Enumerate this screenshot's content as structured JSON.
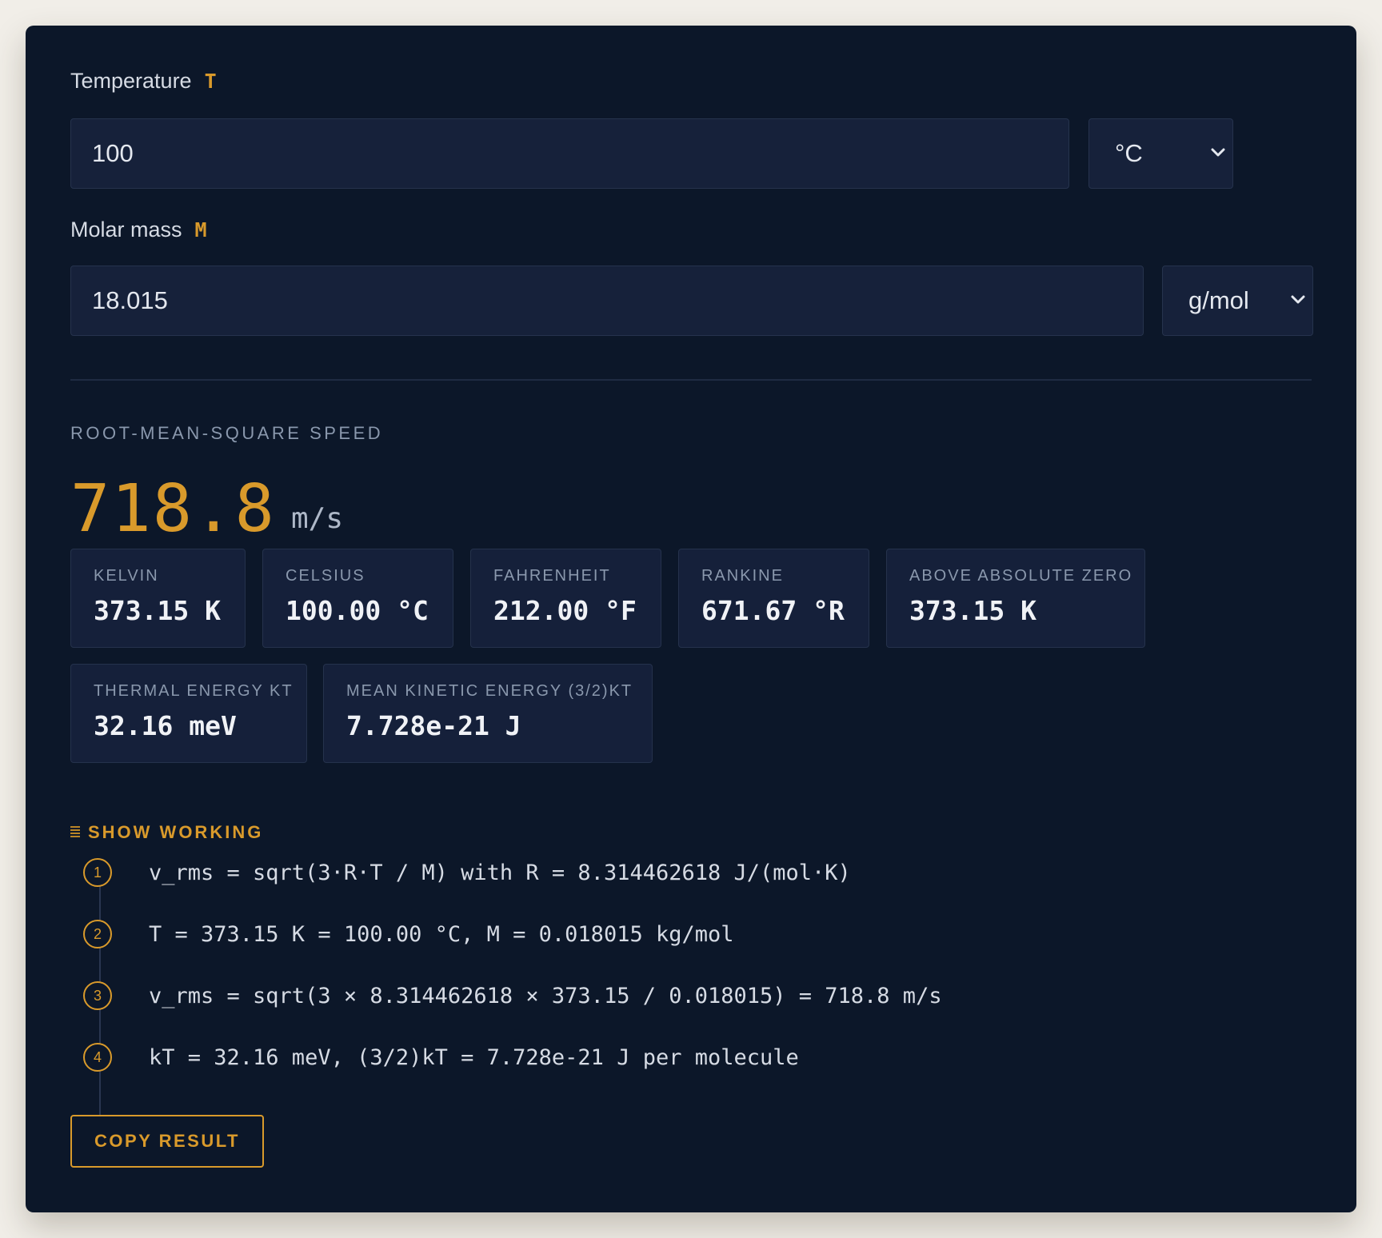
{
  "temperature": {
    "label": "Temperature",
    "symbol": "T",
    "value": "100",
    "unit": "°C"
  },
  "molar_mass": {
    "label": "Molar mass",
    "symbol": "M",
    "value": "18.015",
    "unit": "g/mol"
  },
  "result": {
    "label": "ROOT-MEAN-SQUARE SPEED",
    "value": "718.8",
    "unit": "m/s"
  },
  "stats": [
    {
      "label": "KELVIN",
      "value": "373.15 K"
    },
    {
      "label": "CELSIUS",
      "value": "100.00 °C"
    },
    {
      "label": "FAHRENHEIT",
      "value": "212.00 °F"
    },
    {
      "label": "RANKINE",
      "value": "671.67 °R"
    },
    {
      "label": "ABOVE ABSOLUTE ZERO",
      "value": "373.15 K"
    },
    {
      "label": "THERMAL ENERGY KT",
      "value": "32.16 meV"
    },
    {
      "label": "MEAN KINETIC ENERGY (3/2)KT",
      "value": "7.728e-21 J"
    }
  ],
  "working": {
    "toggle_label": "SHOW WORKING",
    "steps": [
      {
        "num": "1",
        "text": "v_rms = sqrt(3·R·T / M) with R = 8.314462618 J/(mol·K)"
      },
      {
        "num": "2",
        "text": "T = 373.15 K = 100.00 °C, M = 0.018015 kg/mol"
      },
      {
        "num": "3",
        "text": "v_rms = sqrt(3 × 8.314462618 × 373.15 / 0.018015) = 718.8 m/s"
      },
      {
        "num": "4",
        "text": "kT = 32.16 meV, (3/2)kT = 7.728e-21 J per molecule"
      }
    ]
  },
  "copy_button": {
    "label": "COPY RESULT"
  },
  "colors": {
    "background": "#f1eee8",
    "panel": "#0c1729",
    "field": "#16213a",
    "accent": "#d99a2b",
    "text": "#d6dbe4",
    "muted": "#8a98ad"
  },
  "icons": {
    "unit_dropdown": "chevron-down-icon",
    "show_working": "list-icon"
  }
}
